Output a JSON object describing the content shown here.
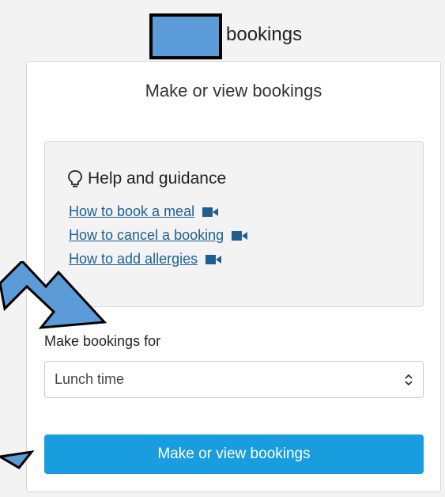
{
  "header": {
    "title": "bookings"
  },
  "card": {
    "title": "Make or view bookings",
    "help": {
      "heading": "Help and guidance",
      "links": [
        {
          "label": "How to book a meal",
          "icon": "video-camera-icon"
        },
        {
          "label": "How to cancel a booking",
          "icon": "video-camera-icon"
        },
        {
          "label": "How to add allergies",
          "icon": "video-camera-icon"
        }
      ]
    },
    "select": {
      "label": "Make bookings for",
      "value": "Lunch time"
    },
    "button": {
      "label": "Make or view bookings"
    }
  },
  "colors": {
    "accent": "#199dde",
    "link": "#1d5f93",
    "annotation": "#5b9bd8"
  }
}
